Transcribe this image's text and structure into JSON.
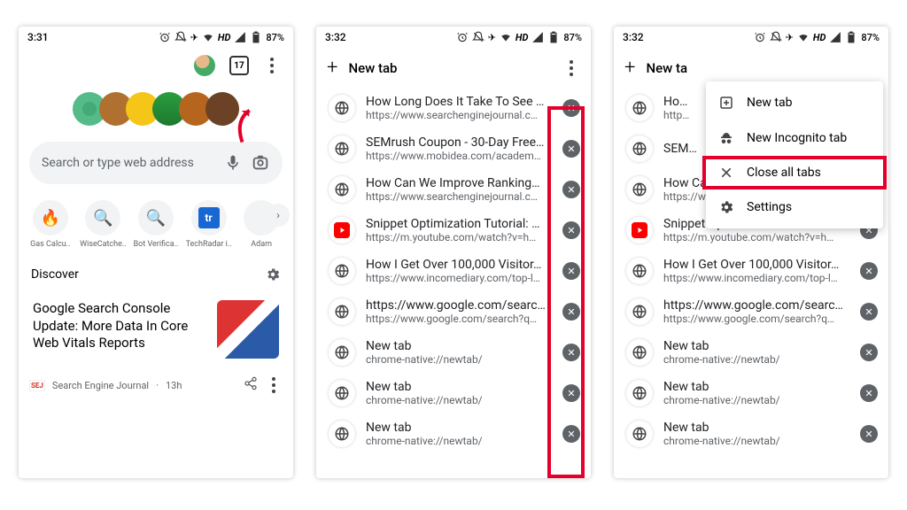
{
  "status": {
    "time1": "3:31",
    "time2": "3:32",
    "time3": "3:32",
    "hd": "HD",
    "battery": "87%"
  },
  "panel1": {
    "tab_count": "17",
    "search_placeholder": "Search or type web address",
    "shortcuts": [
      {
        "label": "Gas Calcu..",
        "icon": "🔥",
        "color": "#d33"
      },
      {
        "label": "WiseCatche..",
        "icon": "🔍",
        "color": "#1a73e8"
      },
      {
        "label": "Bot Verifica..",
        "icon": "🔍",
        "color": "#1a73e8"
      },
      {
        "label": "TechRadar i..",
        "icon": "tr",
        "color": "#1967d2"
      },
      {
        "label": "Adam",
        "icon": "",
        "color": "#888"
      }
    ],
    "discover": "Discover",
    "card_title": "Google Search Console Update: More Data In Core Web Vitals Reports",
    "card_source": "Search Engine Journal",
    "card_time": "13h"
  },
  "tabs_header": "New tab",
  "tabs": [
    {
      "favicon": "globe",
      "title": "How Long Does It Take To See …",
      "url": "https://www.searchenginejournal.c…"
    },
    {
      "favicon": "globe",
      "title": "SEMrush Coupon - 30-Day Free…",
      "url": "https://www.mobidea.com/academ…"
    },
    {
      "favicon": "globe",
      "title": "How Can We Improve Ranking…",
      "url": "https://www.searchenginejournal.c…"
    },
    {
      "favicon": "youtube",
      "title": "Snippet Optimization Tutorial: …",
      "url": "https://m.youtube.com/watch?v=h…"
    },
    {
      "favicon": "globe",
      "title": "How I Get Over 100,000 Visitor…",
      "url": "https://www.incomediary.com/top-l…"
    },
    {
      "favicon": "globe",
      "title": "https://www.google.com/searc…",
      "url": "https://www.google.com/search?q…"
    },
    {
      "favicon": "globe",
      "title": "New tab",
      "url": "chrome-native://newtab/"
    },
    {
      "favicon": "globe",
      "title": "New tab",
      "url": "chrome-native://newtab/"
    },
    {
      "favicon": "globe",
      "title": "New tab",
      "url": "chrome-native://newtab/"
    }
  ],
  "panel3": {
    "truncated_head": "New ta",
    "first_title": "Ho…",
    "first_url": "http…",
    "second_title": "SEM…",
    "visible_tabs_from": 2,
    "menu": [
      {
        "icon": "plus-box",
        "label": "New tab"
      },
      {
        "icon": "incognito",
        "label": "New Incognito tab"
      },
      {
        "icon": "close",
        "label": "Close all tabs",
        "highlight": true
      },
      {
        "icon": "gear",
        "label": "Settings"
      }
    ]
  }
}
